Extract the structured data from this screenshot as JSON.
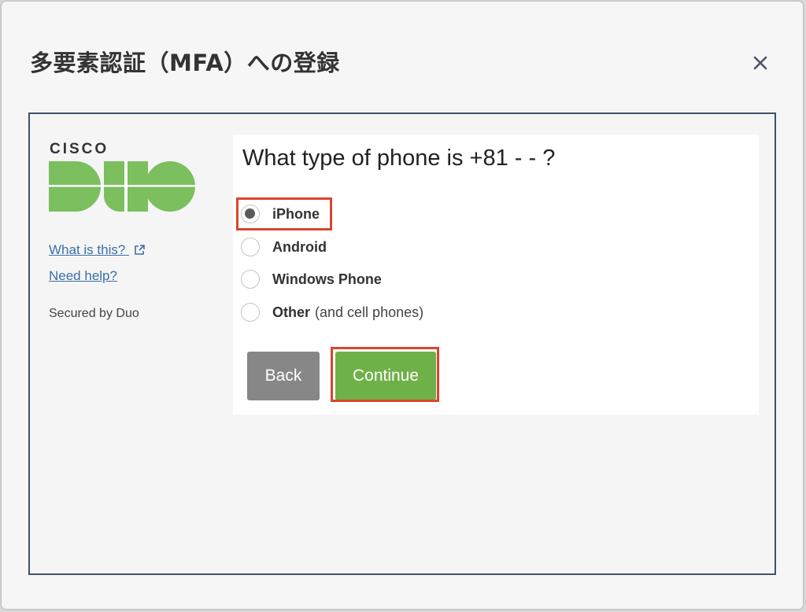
{
  "dialog": {
    "title": "多要素認証（MFA）への登録",
    "close_icon": "close-icon"
  },
  "sidebar": {
    "brand": "CISCO",
    "logo": "duo-logo",
    "logo_color": "#7bbf5e",
    "what_is_this": "What is this?",
    "need_help": "Need help?",
    "secured_by": "Secured by Duo"
  },
  "main": {
    "question": "What type of phone is +81 -  -  ?",
    "options": [
      {
        "label": "iPhone",
        "sub": "",
        "selected": true
      },
      {
        "label": "Android",
        "sub": "",
        "selected": false
      },
      {
        "label": "Windows Phone",
        "sub": "",
        "selected": false
      },
      {
        "label": "Other",
        "sub": "(and cell phones)",
        "selected": false
      }
    ],
    "back_label": "Back",
    "continue_label": "Continue",
    "highlight_color": "#d9452e",
    "continue_color": "#6fb149",
    "back_color": "#878787"
  }
}
